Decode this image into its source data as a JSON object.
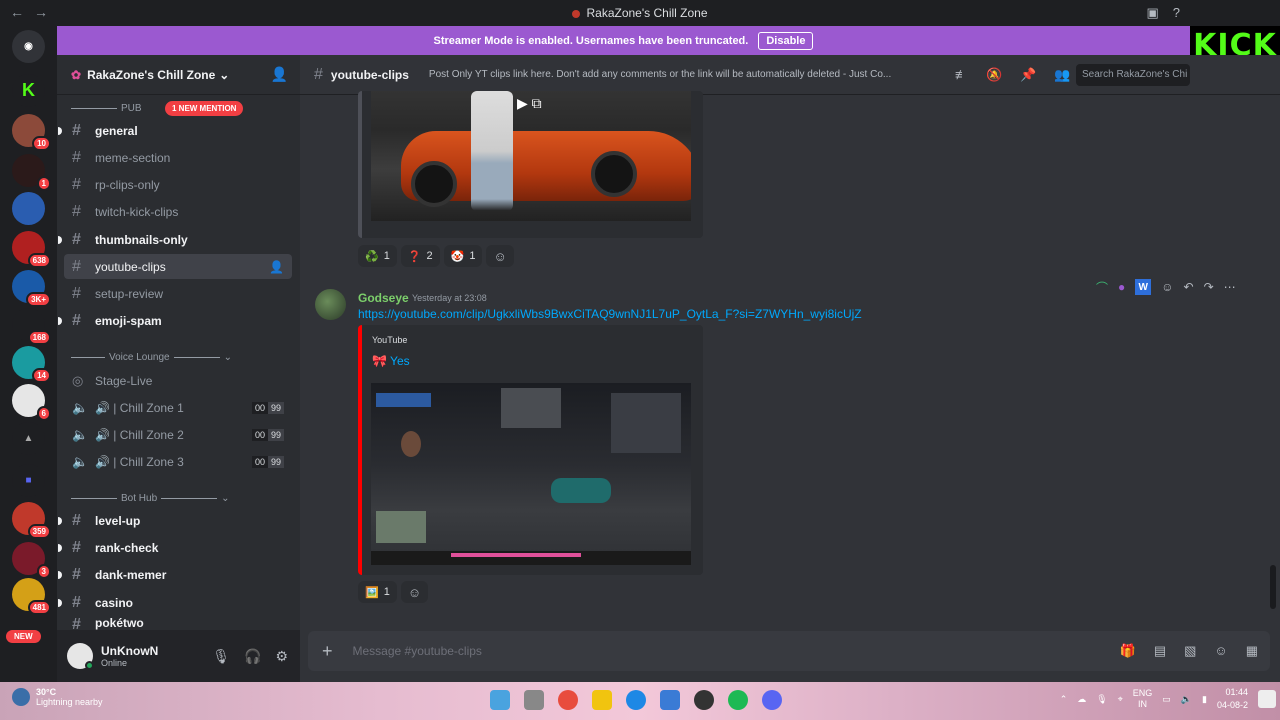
{
  "window": {
    "title": "RakaZone's Chill Zone"
  },
  "banner": {
    "text": "Streamer Mode is enabled. Usernames have been truncated.",
    "button": "Disable"
  },
  "kick_logo": "KICK",
  "rail": {
    "badges": [
      "10",
      "1",
      "638",
      "3K+",
      "168",
      "14",
      "6",
      "359",
      "3",
      "481"
    ],
    "new_label": "NEW"
  },
  "server": {
    "name": "RakaZone's Chill Zone"
  },
  "sidebar": {
    "mention": "1 NEW MENTION",
    "category_public": "PUB",
    "channels": [
      {
        "label": "general"
      },
      {
        "label": "meme-section"
      },
      {
        "label": "rp-clips-only"
      },
      {
        "label": "twitch-kick-clips"
      },
      {
        "label": "thumbnails-only"
      },
      {
        "label": "youtube-clips"
      },
      {
        "label": "setup-review"
      },
      {
        "label": "emoji-spam"
      }
    ],
    "voice_category": "Voice Lounge",
    "voice": [
      {
        "label": "Stage-Live"
      },
      {
        "label": "🔊 | Chill Zone 1",
        "c1": "00",
        "c2": "99"
      },
      {
        "label": "🔊 | Chill Zone 2",
        "c1": "00",
        "c2": "99"
      },
      {
        "label": "🔊 | Chill Zone 3",
        "c1": "00",
        "c2": "99"
      }
    ],
    "bot_category": "Bot Hub",
    "bots": [
      {
        "label": "level-up"
      },
      {
        "label": "rank-check"
      },
      {
        "label": "dank-memer"
      },
      {
        "label": "casino"
      },
      {
        "label": "pokétwo"
      }
    ]
  },
  "user": {
    "name": "UnKnowN",
    "status": "Online"
  },
  "channel": {
    "name": "youtube-clips",
    "topic": "Post Only YT clips link here. Don't add any comments or the link will be automatically deleted - Just Co...",
    "search_placeholder": "Search RakaZone's Chi"
  },
  "messages": {
    "first_reactions": [
      {
        "emoji": "♻️",
        "count": "1"
      },
      {
        "emoji": "❓",
        "count": "2"
      },
      {
        "emoji": "🤡",
        "count": "1"
      }
    ],
    "author": "Godseye",
    "timestamp": "Yesterday at 23:08",
    "link": "https://youtube.com/clip/UgkxliWbs9BwxCiTAQ9wnNJ1L7uP_OytLa_F?si=Z7WYHn_wyi8icUjZ",
    "embed_provider": "YouTube",
    "embed_title": "🎀 Yes",
    "second_reactions": [
      {
        "emoji": "🖼️",
        "count": "1"
      }
    ]
  },
  "composer": {
    "placeholder": "Message #youtube-clips"
  },
  "taskbar": {
    "temperature": "30°C",
    "weather": "Lightning nearby",
    "lang1": "ENG",
    "lang2": "IN",
    "time": "01:44",
    "date": "04-08-2"
  }
}
